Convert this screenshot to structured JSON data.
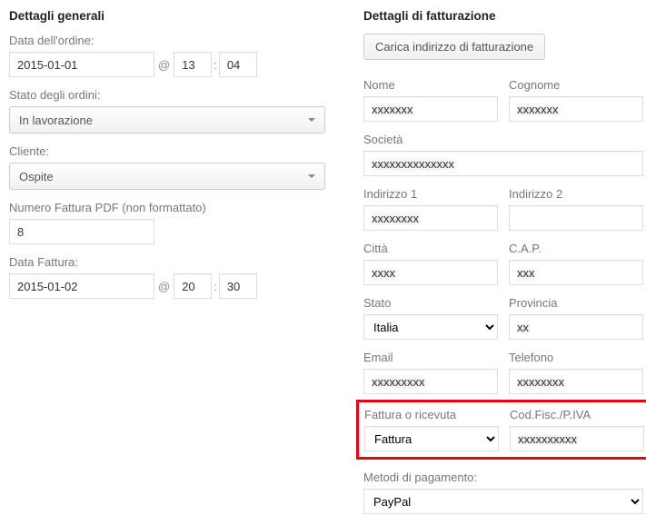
{
  "general": {
    "heading": "Dettagli generali",
    "order_date_label": "Data dell'ordine:",
    "order_date": "2015-01-01",
    "order_date_at": "@",
    "order_hour": "13",
    "order_min": "04",
    "status_label": "Stato degli ordini:",
    "status_value": "In lavorazione",
    "customer_label": "Cliente:",
    "customer_value": "Ospite",
    "invoice_no_label": "Numero Fattura PDF (non formattato)",
    "invoice_no": "8",
    "invoice_date_label": "Data Fattura:",
    "invoice_date": "2015-01-02",
    "invoice_hour": "20",
    "invoice_min": "30"
  },
  "billing": {
    "heading": "Dettagli di fatturazione",
    "load_btn": "Carica indirizzo di fatturazione",
    "first_name_label": "Nome",
    "last_name_label": "Cognome",
    "company_label": "Società",
    "address1_label": "Indirizzo 1",
    "address2_label": "Indirizzo 2",
    "city_label": "Città",
    "postcode_label": "C.A.P.",
    "state_label": "Stato",
    "state_value": "Italia",
    "province_label": "Provincia",
    "email_label": "Email",
    "phone_label": "Telefono",
    "inv_or_rec_label": "Fattura o ricevuta",
    "inv_or_rec_value": "Fattura",
    "fiscal_label": "Cod.Fisc./P.IVA",
    "payment_label": "Metodi di pagamento:",
    "payment_value": "PayPal"
  }
}
